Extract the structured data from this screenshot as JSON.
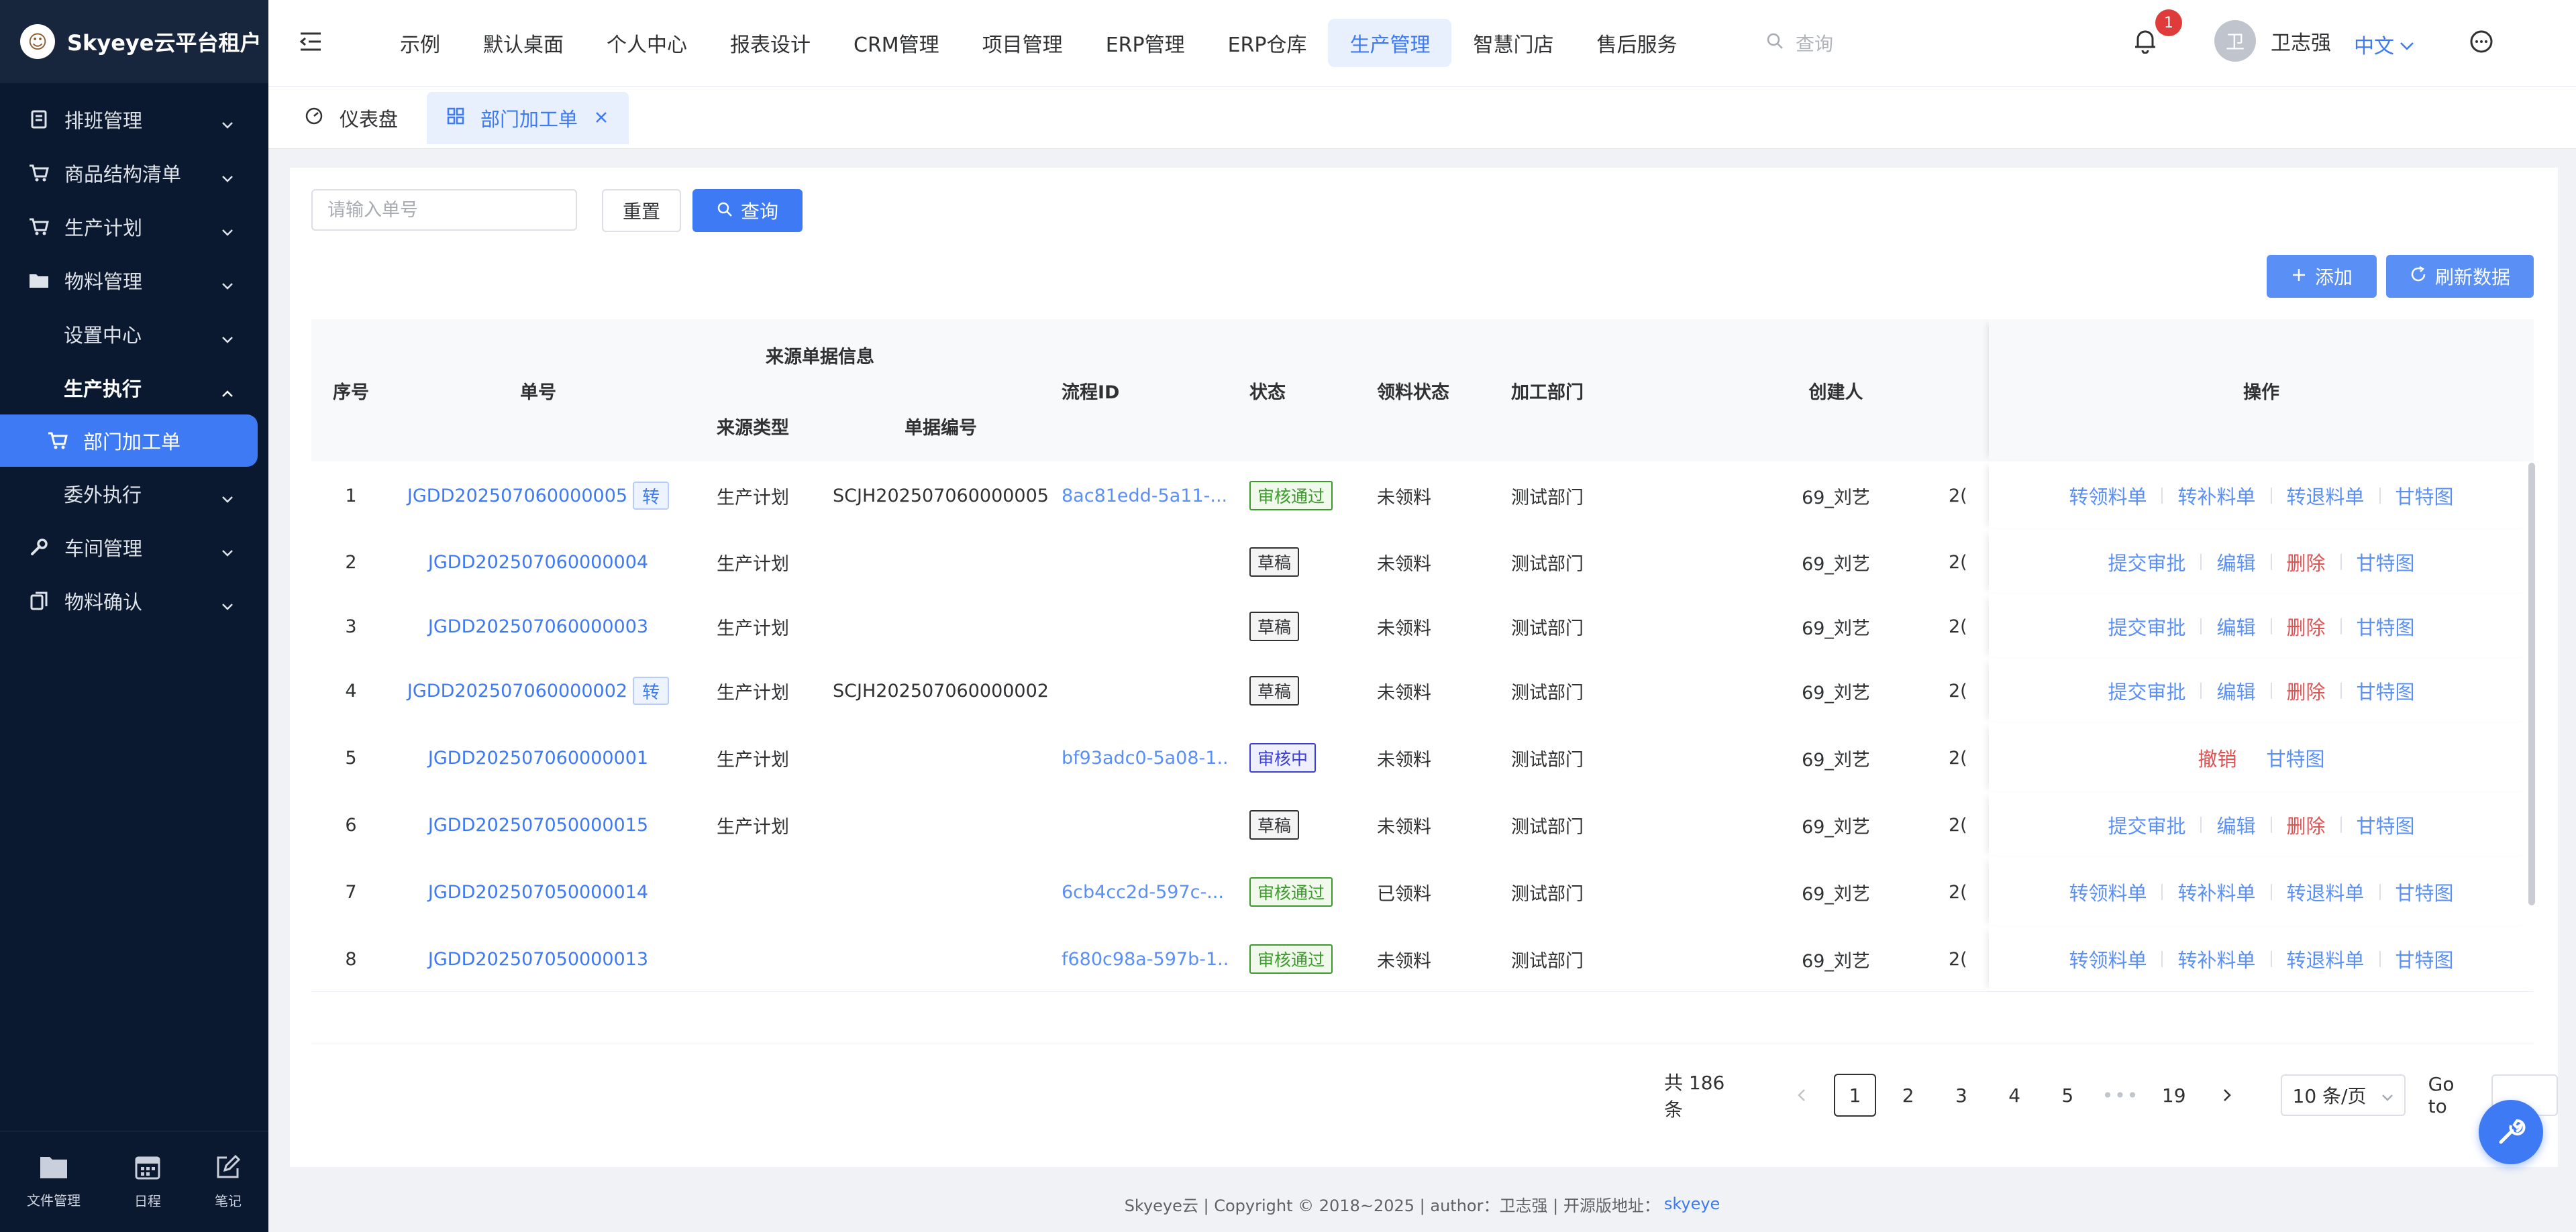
{
  "app": {
    "title": "Skyeye云平台租户"
  },
  "sidebar": {
    "items": [
      {
        "label": "排班管理",
        "icon": "schedule-icon"
      },
      {
        "label": "商品结构清单",
        "icon": "cart-icon"
      },
      {
        "label": "生产计划",
        "icon": "cart-icon"
      },
      {
        "label": "物料管理",
        "icon": "folder-icon"
      },
      {
        "label": "设置中心",
        "icon": ""
      },
      {
        "label": "生产执行",
        "icon": ""
      },
      {
        "label": "部门加工单",
        "icon": "cart-icon"
      },
      {
        "label": "委外执行",
        "icon": ""
      },
      {
        "label": "车间管理",
        "icon": "wrench-icon"
      },
      {
        "label": "物料确认",
        "icon": "copy-icon"
      }
    ],
    "bottom_tools": [
      {
        "label": "文件管理"
      },
      {
        "label": "日程"
      },
      {
        "label": "笔记"
      }
    ]
  },
  "header": {
    "tabs": [
      {
        "label": "示例"
      },
      {
        "label": "默认桌面"
      },
      {
        "label": "个人中心"
      },
      {
        "label": "报表设计"
      },
      {
        "label": "CRM管理"
      },
      {
        "label": "项目管理"
      },
      {
        "label": "ERP管理"
      },
      {
        "label": "ERP仓库"
      },
      {
        "label": "生产管理"
      },
      {
        "label": "智慧门店"
      },
      {
        "label": "售后服务"
      }
    ],
    "active_tab": "生产管理",
    "search_placeholder": "查询",
    "notification_count": "1",
    "avatar_text": "卫",
    "user_name": "卫志强",
    "language": "中文"
  },
  "tags": {
    "home": "仪表盘",
    "current": "部门加工单"
  },
  "filter": {
    "input_placeholder": "请输入单号",
    "reset_label": "重置",
    "query_label": "查询"
  },
  "toolbar": {
    "add_label": "添加",
    "refresh_label": "刷新数据"
  },
  "table": {
    "headers": {
      "index": "序号",
      "order_no": "单号",
      "source_group": "来源单据信息",
      "source_type": "来源类型",
      "source_no": "单据编号",
      "flow_id": "流程ID",
      "status": "状态",
      "pick_status": "领料状态",
      "dept": "加工部门",
      "creator": "创建人",
      "ops": "操作"
    },
    "transfer_tag": "转",
    "rows": [
      {
        "index": "1",
        "order_no": "JGDD202507060000005",
        "has_tag": true,
        "source_type": "生产计划",
        "source_no": "SCJH202507060000005",
        "flow_id": "8ac81edd-5a11-...",
        "status": "审核通过",
        "status_kind": "pass",
        "pick_status": "未领料",
        "dept": "测试部门",
        "creator": "69_刘艺",
        "date_clip": "2(",
        "ops": [
          "转领料单",
          "转补料单",
          "转退料单",
          "甘特图"
        ]
      },
      {
        "index": "2",
        "order_no": "JGDD202507060000004",
        "has_tag": false,
        "source_type": "生产计划",
        "source_no": "",
        "flow_id": "",
        "status": "草稿",
        "status_kind": "draft",
        "pick_status": "未领料",
        "dept": "测试部门",
        "creator": "69_刘艺",
        "date_clip": "2(",
        "ops": [
          "提交审批",
          "编辑",
          "删除",
          "甘特图"
        ]
      },
      {
        "index": "3",
        "order_no": "JGDD202507060000003",
        "has_tag": false,
        "source_type": "生产计划",
        "source_no": "",
        "flow_id": "",
        "status": "草稿",
        "status_kind": "draft",
        "pick_status": "未领料",
        "dept": "测试部门",
        "creator": "69_刘艺",
        "date_clip": "2(",
        "ops": [
          "提交审批",
          "编辑",
          "删除",
          "甘特图"
        ]
      },
      {
        "index": "4",
        "order_no": "JGDD202507060000002",
        "has_tag": true,
        "source_type": "生产计划",
        "source_no": "SCJH202507060000002",
        "flow_id": "",
        "status": "草稿",
        "status_kind": "draft",
        "pick_status": "未领料",
        "dept": "测试部门",
        "creator": "69_刘艺",
        "date_clip": "2(",
        "ops": [
          "提交审批",
          "编辑",
          "删除",
          "甘特图"
        ]
      },
      {
        "index": "5",
        "order_no": "JGDD202507060000001",
        "has_tag": false,
        "source_type": "生产计划",
        "source_no": "",
        "flow_id": "bf93adc0-5a08-1...",
        "status": "审核中",
        "status_kind": "mid",
        "pick_status": "未领料",
        "dept": "测试部门",
        "creator": "69_刘艺",
        "date_clip": "2(",
        "ops": [
          "撤销",
          "甘特图"
        ]
      },
      {
        "index": "6",
        "order_no": "JGDD202507050000015",
        "has_tag": false,
        "source_type": "生产计划",
        "source_no": "",
        "flow_id": "",
        "status": "草稿",
        "status_kind": "draft",
        "pick_status": "未领料",
        "dept": "测试部门",
        "creator": "69_刘艺",
        "date_clip": "2(",
        "ops": [
          "提交审批",
          "编辑",
          "删除",
          "甘特图"
        ]
      },
      {
        "index": "7",
        "order_no": "JGDD202507050000014",
        "has_tag": false,
        "source_type": "",
        "source_no": "",
        "flow_id": "6cb4cc2d-597c-...",
        "status": "审核通过",
        "status_kind": "pass",
        "pick_status": "已领料",
        "dept": "测试部门",
        "creator": "69_刘艺",
        "date_clip": "2(",
        "ops": [
          "转领料单",
          "转补料单",
          "转退料单",
          "甘特图"
        ]
      },
      {
        "index": "8",
        "order_no": "JGDD202507050000013",
        "has_tag": false,
        "source_type": "",
        "source_no": "",
        "flow_id": "f680c98a-597b-1...",
        "status": "审核通过",
        "status_kind": "pass",
        "pick_status": "未领料",
        "dept": "测试部门",
        "creator": "69_刘艺",
        "date_clip": "2(",
        "ops": [
          "转领料单",
          "转补料单",
          "转退料单",
          "甘特图"
        ]
      }
    ]
  },
  "pagination": {
    "total_text": "共 186 条",
    "pages": [
      "1",
      "2",
      "3",
      "4",
      "5"
    ],
    "last_page": "19",
    "current": "1",
    "ellipsis": "•••",
    "page_size": "10 条/页",
    "goto_label": "Go to"
  },
  "footer": {
    "text": "Skyeye云 | Copyright © 2018~2025 | author：卫志强 | 开源版地址：",
    "link": "skyeye"
  },
  "colors": {
    "primary": "#3d7af3",
    "sidebar": "#0b1930",
    "danger": "#e05353",
    "success": "#3c9a2c"
  }
}
